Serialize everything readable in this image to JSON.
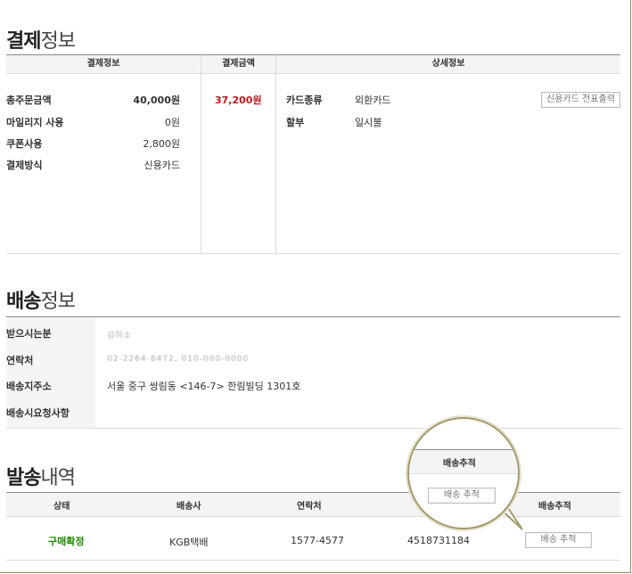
{
  "payment": {
    "title_bold": "결제",
    "title_light": "정보",
    "headers": {
      "info": "결제정보",
      "amount": "결제금액",
      "detail": "상세정보"
    },
    "rows": [
      {
        "label": "총주문금액",
        "value": "40,000원",
        "bold": true
      },
      {
        "label": "마일리지 사용",
        "value": "0원",
        "bold": false
      },
      {
        "label": "쿠폰사용",
        "value": "2,800원",
        "bold": false
      },
      {
        "label": "결제방식",
        "value": "신용카드",
        "bold": false
      }
    ],
    "total": "37,200원",
    "card_type_label": "카드종류",
    "card_type_value": "외환카드",
    "installment_label": "할부",
    "installment_value": "일시불",
    "receipt_button": "신용카드 전표출력"
  },
  "shipping": {
    "title_bold": "배송",
    "title_light": "정보",
    "recipient_label": "받으시는분",
    "recipient_value": "김미소",
    "contact_label": "연락처",
    "contact_value": "02-2264-8472, 010-000-0000",
    "address_label": "배송지주소",
    "address_value": "서울 중구 쌍림동 <146-7> 한림빌딩 1301호",
    "request_label": "배송시요청사항",
    "request_value": ""
  },
  "dispatch": {
    "title_bold": "발송",
    "title_light": "내역",
    "headers": {
      "status": "상태",
      "carrier": "배송사",
      "phone": "연락처",
      "tracking_no": "송장번호",
      "track": "배송추적"
    },
    "row": {
      "status": "구매확정",
      "carrier": "KGB택배",
      "phone": "1577-4577",
      "tracking_no": "4518731184",
      "track_button": "배송 추적"
    },
    "magnifier": {
      "header": "배송추적",
      "button": "배송 추적"
    }
  }
}
